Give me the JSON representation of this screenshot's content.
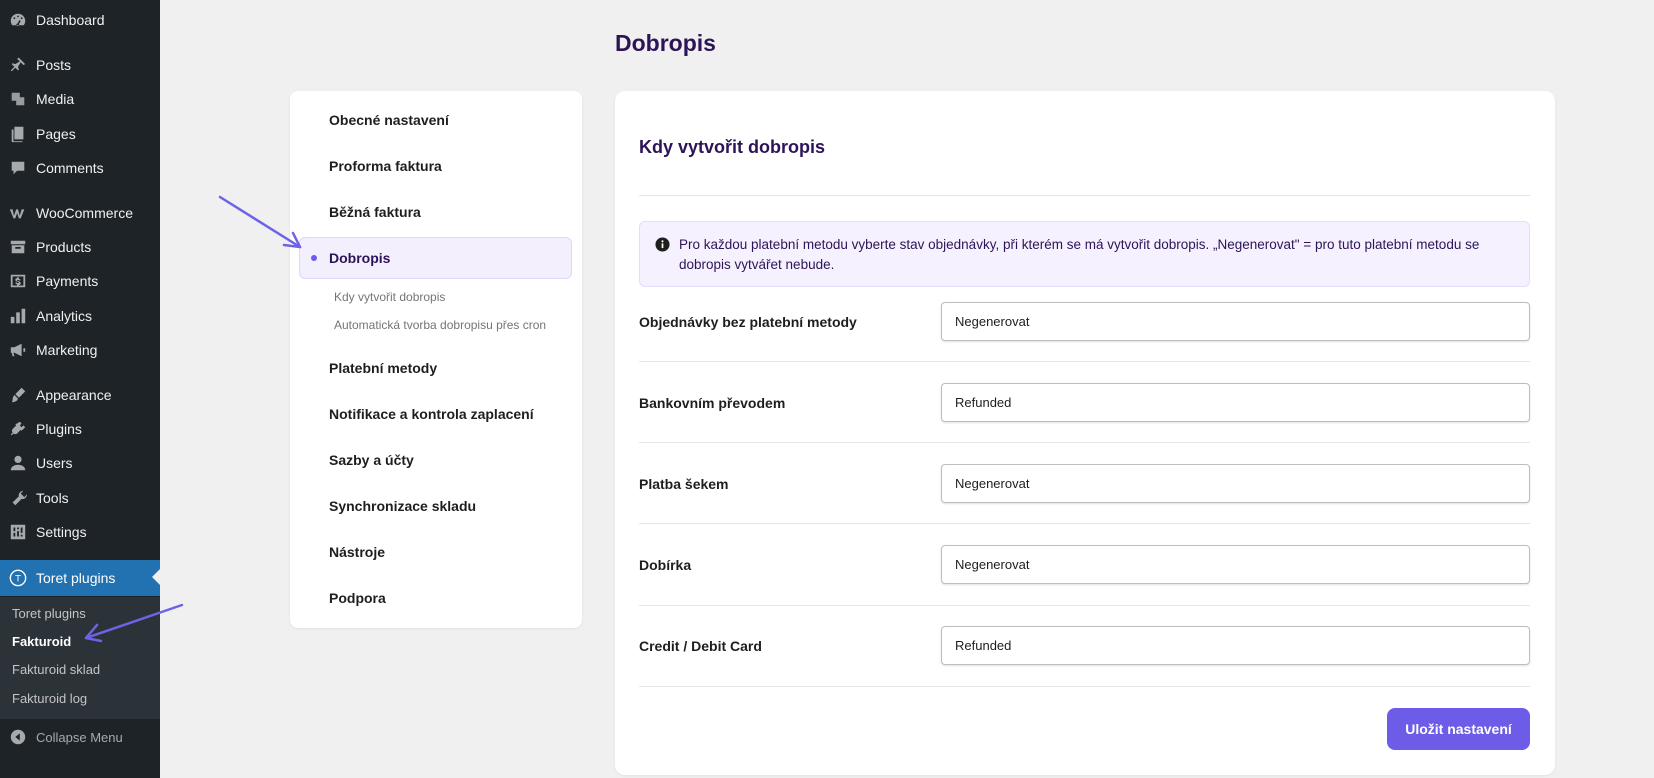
{
  "admin_menu": {
    "items": [
      {
        "label": "Dashboard",
        "icon": "dashboard-icon"
      },
      {
        "label": "Posts",
        "icon": "pin-icon"
      },
      {
        "label": "Media",
        "icon": "media-icon"
      },
      {
        "label": "Pages",
        "icon": "pages-icon"
      },
      {
        "label": "Comments",
        "icon": "comment-icon"
      },
      {
        "label": "WooCommerce",
        "icon": "woocommerce-icon"
      },
      {
        "label": "Products",
        "icon": "archive-icon"
      },
      {
        "label": "Payments",
        "icon": "dollar-icon"
      },
      {
        "label": "Analytics",
        "icon": "bar-chart-icon"
      },
      {
        "label": "Marketing",
        "icon": "megaphone-icon"
      },
      {
        "label": "Appearance",
        "icon": "brush-icon"
      },
      {
        "label": "Plugins",
        "icon": "plugin-icon"
      },
      {
        "label": "Users",
        "icon": "user-icon"
      },
      {
        "label": "Tools",
        "icon": "wrench-icon"
      },
      {
        "label": "Settings",
        "icon": "settings-icon"
      },
      {
        "label": "Toret plugins",
        "icon": "toret-icon"
      }
    ],
    "submenu": [
      "Toret plugins",
      "Fakturoid",
      "Fakturoid sklad",
      "Fakturoid log"
    ],
    "collapse_label": "Collapse Menu",
    "toret_glyph": "T"
  },
  "page": {
    "title": "Dobropis"
  },
  "settings_nav": {
    "items": [
      "Obecné nastavení",
      "Proforma faktura",
      "Běžná faktura",
      "Dobropis",
      "Platební metody",
      "Notifikace a kontrola zaplacení",
      "Sazby a účty",
      "Synchronizace skladu",
      "Nástroje",
      "Podpora"
    ],
    "subitems": [
      "Kdy vytvořit dobropis",
      "Automatická tvorba dobropisu přes cron"
    ]
  },
  "section": {
    "title": "Kdy vytvořit dobropis",
    "notice": "Pro každou platební metodu vyberte stav objednávky, při kterém se má vytvořit dobropis. „Negenerovat\" = pro tuto platební metodu se dobropis vytvářet nebude.",
    "rows": [
      {
        "label": "Objednávky bez platební metody",
        "value": "Negenerovat"
      },
      {
        "label": "Bankovním převodem",
        "value": "Refunded"
      },
      {
        "label": "Platba šekem",
        "value": "Negenerovat"
      },
      {
        "label": "Dobírka",
        "value": "Negenerovat"
      },
      {
        "label": "Credit / Debit Card",
        "value": "Refunded"
      }
    ],
    "save_label": "Uložit nastavení"
  },
  "colors": {
    "accent": "#6c5ce7",
    "title": "#2d1457",
    "admin_bg": "#1d2327",
    "admin_current": "#2271b1"
  }
}
